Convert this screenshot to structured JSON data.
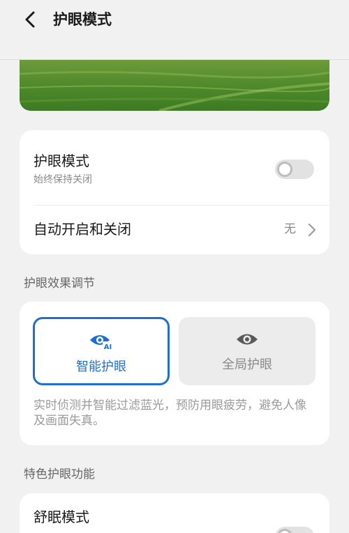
{
  "header": {
    "title": "护眼模式"
  },
  "main_toggle_card": {
    "title": "护眼模式",
    "subtitle": "始终保持关闭",
    "enabled": false,
    "schedule_label": "自动开启和关闭",
    "schedule_value": "无"
  },
  "effect_section": {
    "label": "护眼效果调节",
    "options": [
      {
        "label": "智能护眼",
        "icon": "ai-eye-icon",
        "selected": true,
        "badge": "AI"
      },
      {
        "label": "全局护眼",
        "icon": "eye-icon",
        "selected": false
      }
    ],
    "description": "实时侦测并智能过滤蓝光，预防用眼疲劳，避免人像及画面失真。"
  },
  "feature_section": {
    "label": "特色护眼功能",
    "items": [
      {
        "title": "舒眠模式",
        "enabled": false
      }
    ]
  },
  "colors": {
    "accent": "#1e6fd0",
    "background": "#f1f1f1",
    "card": "#ffffff"
  }
}
